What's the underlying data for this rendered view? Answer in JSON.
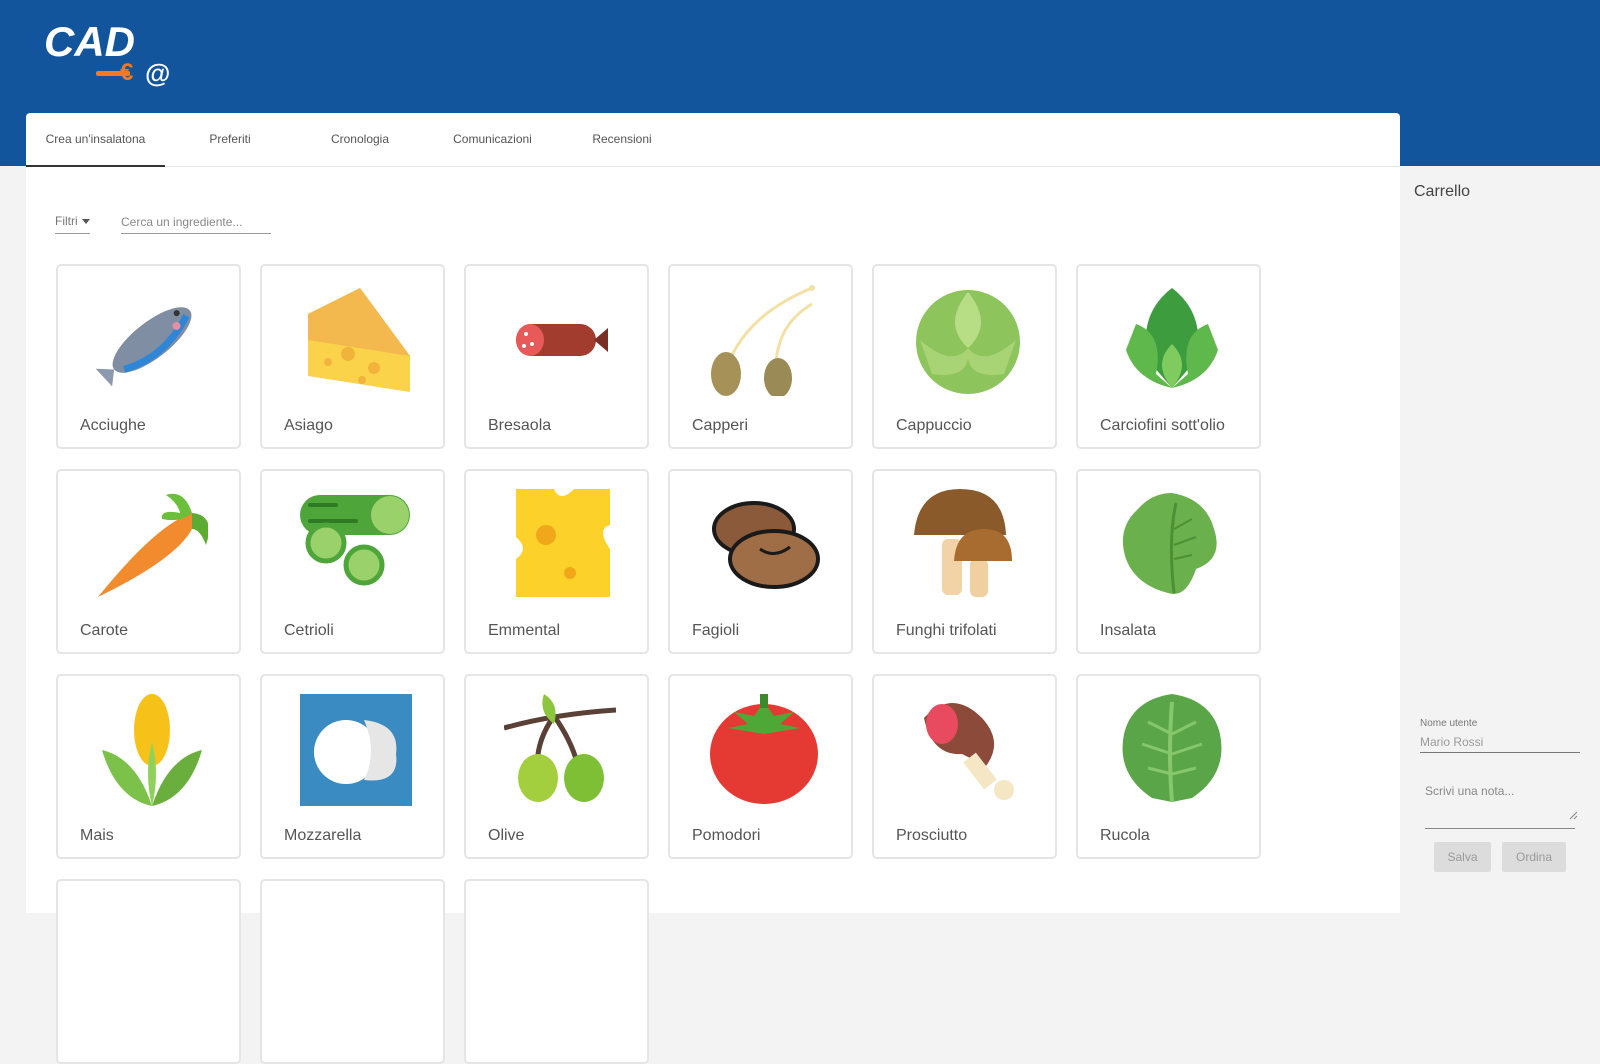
{
  "brand": {
    "logo_text": "CAD",
    "logo_suffix": "@"
  },
  "tabs": [
    {
      "label": "Crea un'insalatona",
      "active": true
    },
    {
      "label": "Preferiti"
    },
    {
      "label": "Cronologia"
    },
    {
      "label": "Comunicazioni"
    },
    {
      "label": "Recensioni"
    }
  ],
  "filters": {
    "label": "Filtri",
    "search_placeholder": "Cerca un ingrediente..."
  },
  "ingredients": [
    {
      "name": "Acciughe",
      "icon": "anchovy-icon"
    },
    {
      "name": "Asiago",
      "icon": "cheese-wedge-icon"
    },
    {
      "name": "Bresaola",
      "icon": "salami-icon"
    },
    {
      "name": "Capperi",
      "icon": "capers-icon"
    },
    {
      "name": "Cappuccio",
      "icon": "cabbage-icon"
    },
    {
      "name": "Carciofini sott'olio",
      "icon": "artichoke-icon"
    },
    {
      "name": "Carote",
      "icon": "carrot-icon"
    },
    {
      "name": "Cetrioli",
      "icon": "cucumber-icon"
    },
    {
      "name": "Emmental",
      "icon": "swiss-cheese-icon"
    },
    {
      "name": "Fagioli",
      "icon": "beans-icon"
    },
    {
      "name": "Funghi trifolati",
      "icon": "mushroom-icon"
    },
    {
      "name": "Insalata",
      "icon": "lettuce-icon"
    },
    {
      "name": "Mais",
      "icon": "corn-icon"
    },
    {
      "name": "Mozzarella",
      "icon": "mozzarella-icon"
    },
    {
      "name": "Olive",
      "icon": "olive-icon"
    },
    {
      "name": "Pomodori",
      "icon": "tomato-icon"
    },
    {
      "name": "Prosciutto",
      "icon": "ham-leg-icon"
    },
    {
      "name": "Rucola",
      "icon": "arugula-icon"
    }
  ],
  "cart": {
    "title": "Carrello",
    "user_label": "Nome utente",
    "user_value": "Mario Rossi",
    "note_placeholder": "Scrivi una nota...",
    "save_label": "Salva",
    "order_label": "Ordina"
  },
  "colors": {
    "header": "#12559c",
    "logo_accent": "#f47a20"
  }
}
